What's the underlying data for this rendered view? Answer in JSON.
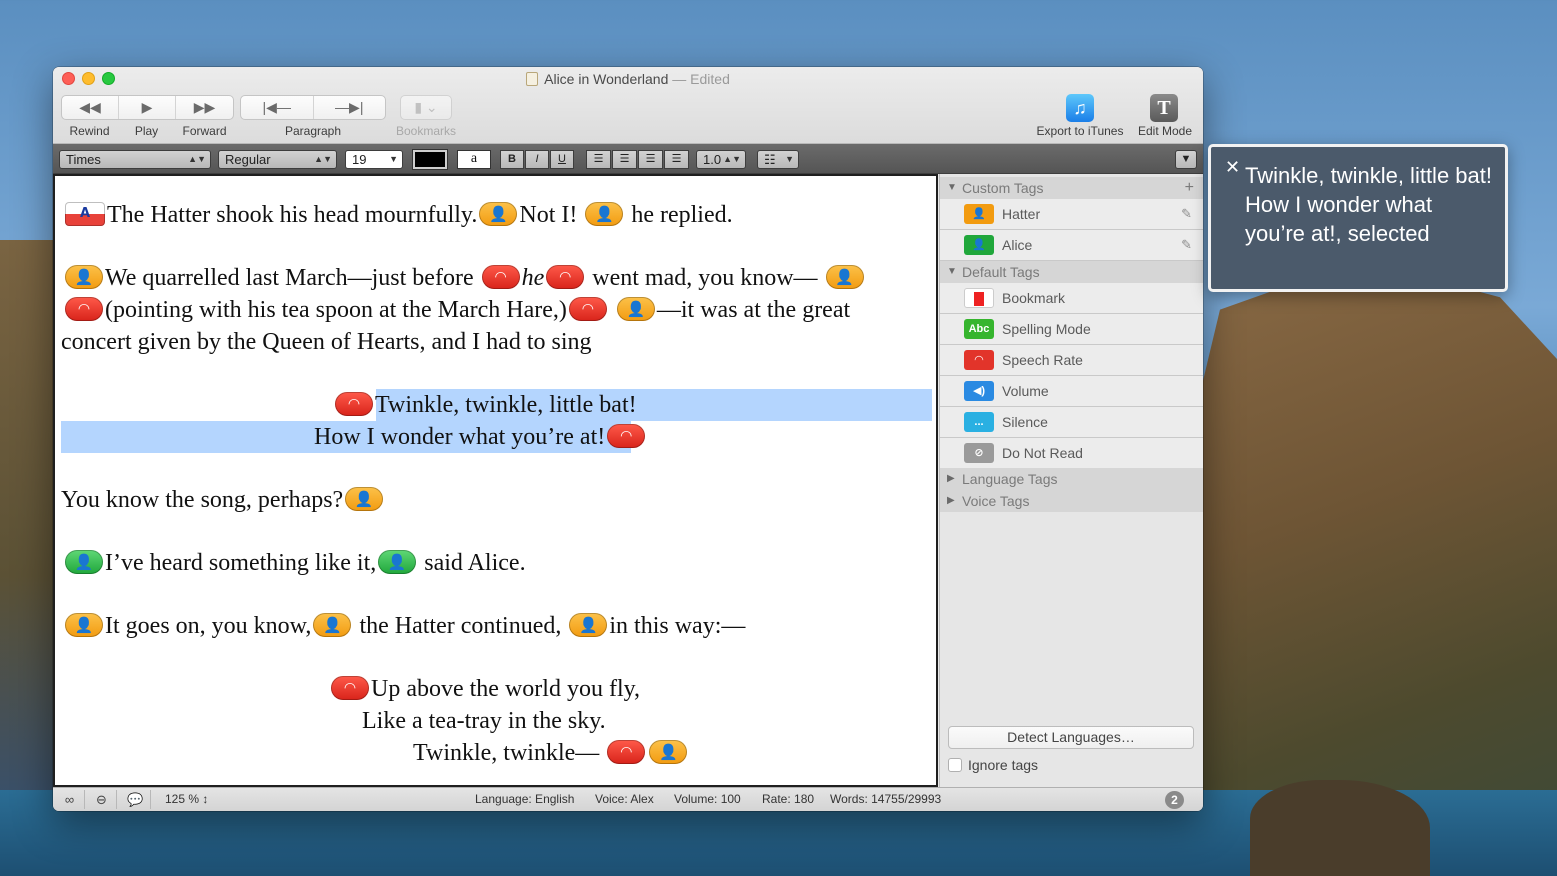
{
  "window": {
    "title": "Alice in Wonderland",
    "status_suffix": "— Edited"
  },
  "toolbar": {
    "rewind": "Rewind",
    "play": "Play",
    "forward": "Forward",
    "paragraph": "Paragraph",
    "bookmarks": "Bookmarks",
    "export": "Export to iTunes",
    "edit_mode": "Edit Mode"
  },
  "format": {
    "font": "Times",
    "style": "Regular",
    "size": "19",
    "bold": "B",
    "italic": "I",
    "underline": "U",
    "bg_sample": "a",
    "spacing": "1.0"
  },
  "editor": {
    "p1": "The Hatter shook his head mournfully.",
    "p1b": "Not I!",
    "p1c": "he replied.",
    "p2a": "We quarrelled last March—just before",
    "p2he": "he",
    "p2b": "went mad, you know—",
    "p3a": "(pointing with his tea spoon at the March Hare,)",
    "p3b": "—it was at the great",
    "p4": "concert given by the Queen of Hearts, and I had to sing",
    "song1": "Twinkle, twinkle, little bat!",
    "song2": "How I wonder what you’re at!",
    "p5": "You know the song, perhaps?",
    "p6a": "I’ve heard something like it,",
    "p6b": "said Alice.",
    "p7a": "It goes on, you know,",
    "p7b": "the Hatter continued,",
    "p7c": "in this way:—",
    "v1": "Up above the world you fly,",
    "v2": "Like a tea-tray in the sky.",
    "v3": "Twinkle, twinkle—"
  },
  "sidebar": {
    "custom_header": "Custom Tags",
    "custom_items": [
      "Hatter",
      "Alice"
    ],
    "default_header": "Default Tags",
    "default_items": [
      "Bookmark",
      "Spelling Mode",
      "Speech Rate",
      "Volume",
      "Silence",
      "Do Not Read"
    ],
    "spelling_icon_text": "Abc",
    "silence_icon_text": "...",
    "language_header": "Language Tags",
    "voice_header": "Voice Tags",
    "detect_button": "Detect Languages…",
    "ignore_label": "Ignore tags"
  },
  "status": {
    "zoom": "125 %",
    "language": "Language: English",
    "voice": "Voice: Alex",
    "volume": "Volume: 100",
    "rate": "Rate: 180",
    "words": "Words: 14755/29993",
    "badge": "2"
  },
  "overlay": {
    "text": "Twinkle, twinkle, little bat!\nHow I wonder what you’re at!, selected"
  },
  "colors": {
    "selection": "#b4d5fe",
    "tag_orange": "#f29b10",
    "tag_red": "#d8231a",
    "tag_green": "#20a73b",
    "overlay_bg": "#4b5a6b"
  }
}
